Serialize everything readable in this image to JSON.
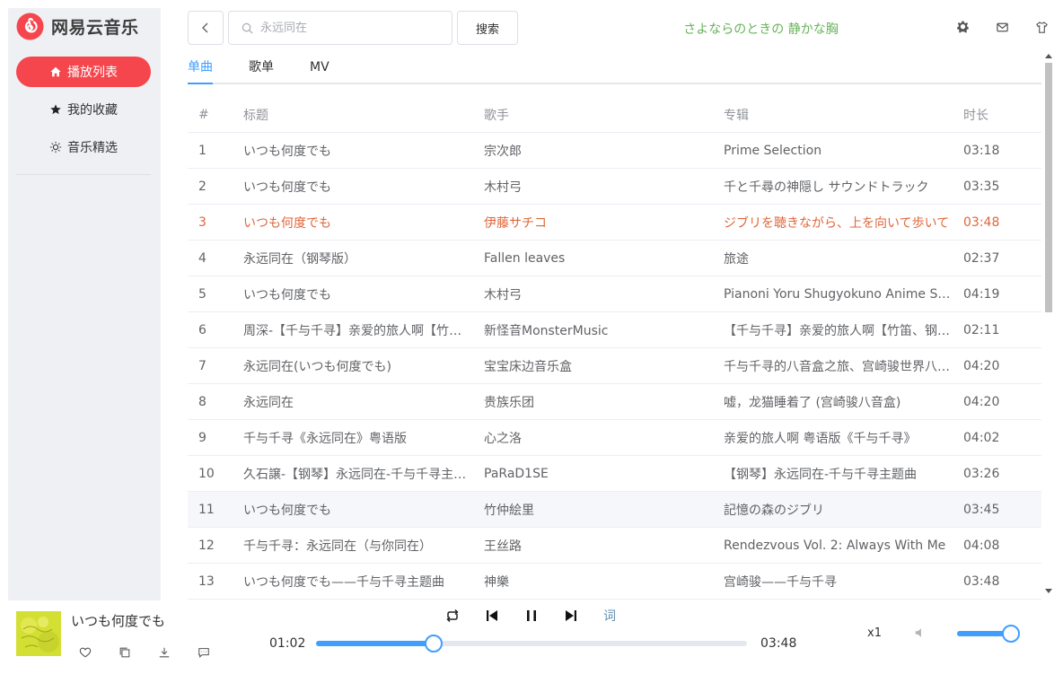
{
  "app": {
    "name": "网易云音乐",
    "brand_color": "#f5464e",
    "accent_color": "#409eff"
  },
  "sidebar": {
    "items": [
      {
        "label": "播放列表",
        "icon": "home-icon",
        "active": true
      },
      {
        "label": "我的收藏",
        "icon": "star-icon",
        "active": false
      },
      {
        "label": "音乐精选",
        "icon": "sun-icon",
        "active": false
      }
    ]
  },
  "header": {
    "search_placeholder": "永远同在",
    "search_button": "搜索",
    "current_lyric": "さよならのときの 静かな胸",
    "icons": [
      "settings-icon",
      "mail-icon",
      "shirt-icon"
    ]
  },
  "tabs": [
    {
      "label": "单曲",
      "active": true
    },
    {
      "label": "歌单",
      "active": false
    },
    {
      "label": "MV",
      "active": false
    }
  ],
  "table": {
    "columns": [
      "#",
      "标题",
      "歌手",
      "专辑",
      "时长"
    ],
    "rows": [
      {
        "idx": "1",
        "title": "いつも何度でも",
        "artist": "宗次郎",
        "album": "Prime Selection",
        "time": "03:18"
      },
      {
        "idx": "2",
        "title": "いつも何度でも",
        "artist": "木村弓",
        "album": "千と千尋の神隠し サウンドトラック",
        "time": "03:35"
      },
      {
        "idx": "3",
        "title": "いつも何度でも",
        "artist": "伊藤サチコ",
        "album": "ジブリを聴きながら、上を向いて歩いて",
        "time": "03:48",
        "playing": true
      },
      {
        "idx": "4",
        "title": "永远同在（钢琴版）",
        "artist": "Fallen leaves",
        "album": "旅途",
        "time": "02:37"
      },
      {
        "idx": "5",
        "title": "いつも何度でも",
        "artist": "木村弓",
        "album": "Pianoni Yoru Shugyokuno Anime Song",
        "time": "04:19"
      },
      {
        "idx": "6",
        "title": "周深-【千与千寻】亲爱的旅人啊【竹笛、钢琴】",
        "artist": "新怪音MonsterMusic",
        "album": "【千与千寻】亲爱的旅人啊【竹笛、钢琴】",
        "time": "02:11"
      },
      {
        "idx": "7",
        "title": "永远同在(いつも何度でも)",
        "artist": "宝宝床边音乐盒",
        "album": "千与千寻的八音盒之旅、宫崎骏世界八音盒",
        "time": "04:20"
      },
      {
        "idx": "8",
        "title": "永远同在",
        "artist": "贵族乐团",
        "album": "嘘，龙猫睡着了 (宫崎骏八音盒)",
        "time": "04:20"
      },
      {
        "idx": "9",
        "title": "千与千寻《永远同在》粤语版",
        "artist": "心之洛",
        "album": "亲爱的旅人啊 粤语版《千与千寻》",
        "time": "04:02"
      },
      {
        "idx": "10",
        "title": "久石譲-【钢琴】永远同在-千与千寻主题曲",
        "artist": "PaRaD1SE",
        "album": "【钢琴】永远同在-千与千寻主题曲",
        "time": "03:26"
      },
      {
        "idx": "11",
        "title": "いつも何度でも",
        "artist": "竹仲絵里",
        "album": "記憶の森のジブリ",
        "time": "03:45",
        "hover": true
      },
      {
        "idx": "12",
        "title": "千与千寻：永远同在（与你同在）",
        "artist": "王丝路",
        "album": "Rendezvous Vol. 2: Always With Me",
        "time": "04:08"
      },
      {
        "idx": "13",
        "title": "いつも何度でも——千与千寻主题曲",
        "artist": "神樂",
        "album": "宫崎骏——千与千寻",
        "time": "03:48"
      }
    ]
  },
  "player": {
    "song_title": "いつも何度でも",
    "current_time": "01:02",
    "total_time": "03:48",
    "progress": 0.272,
    "lyric_button": "词",
    "speed": "x1",
    "volume": 1.0,
    "action_icons": [
      "heart-icon",
      "copy-icon",
      "download-icon",
      "comment-icon"
    ],
    "control_icons": [
      "loop-icon",
      "previous-icon",
      "pause-icon",
      "next-icon"
    ]
  }
}
